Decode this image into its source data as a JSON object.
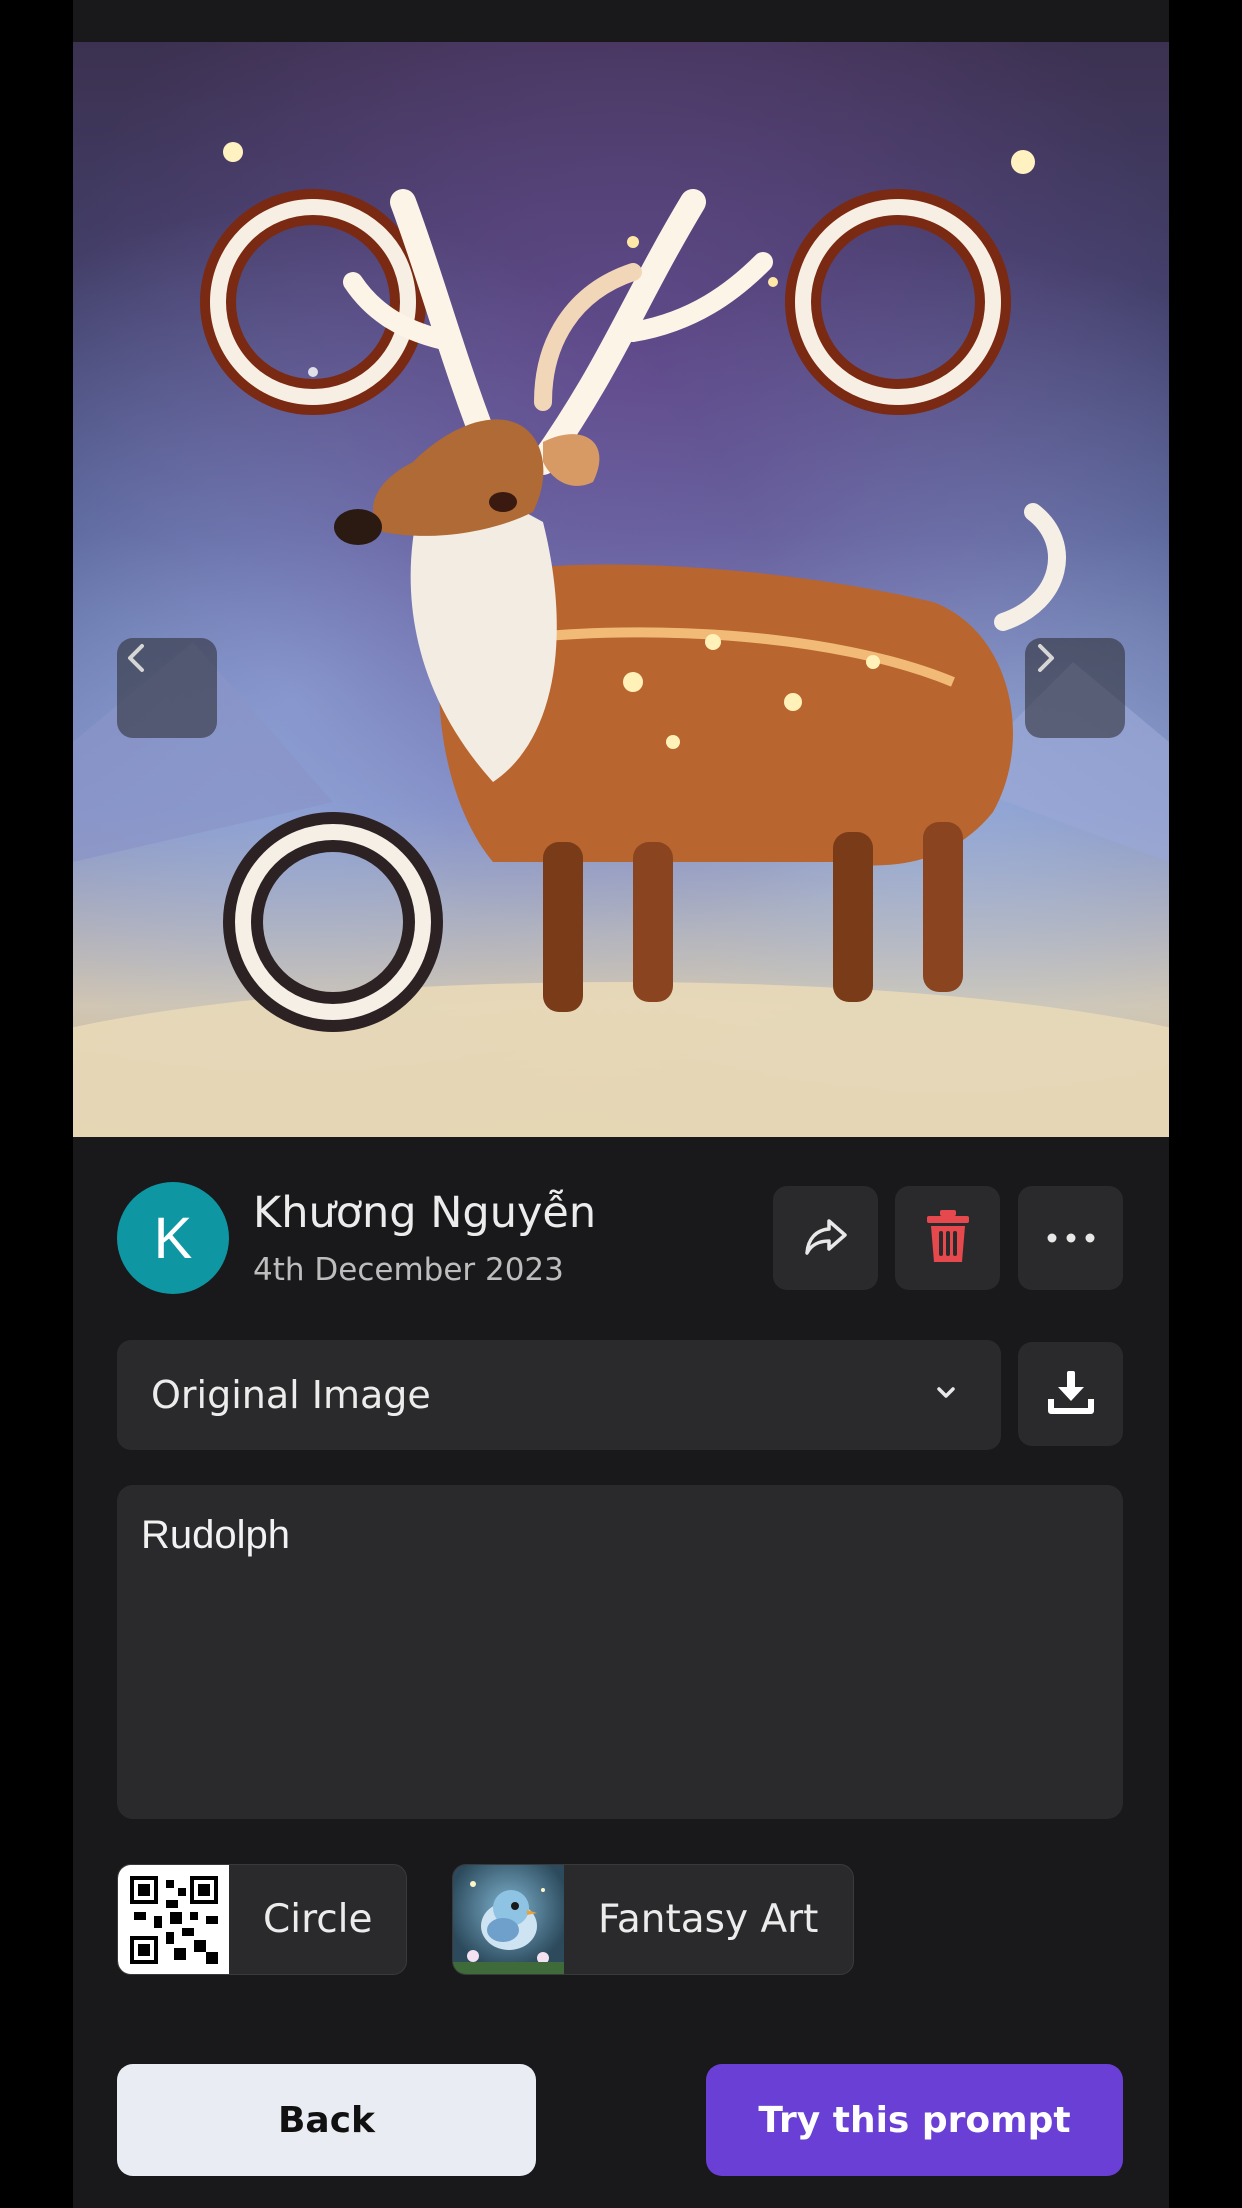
{
  "viewer": {
    "image_subject": "reindeer-artwork",
    "prev_icon": "chevron-left-icon",
    "next_icon": "chevron-right-icon"
  },
  "author": {
    "avatar_letter": "K",
    "avatar_color": "#0e97a3",
    "name": "Khương Nguyễn",
    "date": "4th December 2023"
  },
  "actions": {
    "share_icon": "share-icon",
    "delete_icon": "trash-icon",
    "delete_color": "#e5484d",
    "more_icon": "more-horizontal-icon"
  },
  "variant_select": {
    "selected": "Original Image",
    "icon": "chevron-down-icon",
    "download_icon": "download-icon"
  },
  "prompt": {
    "text": "Rudolph"
  },
  "tags": [
    {
      "label": "Circle",
      "thumb": "qr-code-thumbnail"
    },
    {
      "label": "Fantasy Art",
      "thumb": "bird-thumbnail"
    }
  ],
  "buttons": {
    "back_label": "Back",
    "try_label": "Try this prompt",
    "try_color": "#6a3fd6"
  }
}
